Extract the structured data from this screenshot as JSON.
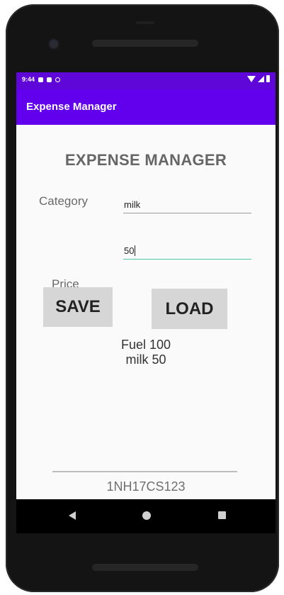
{
  "status_bar": {
    "time": "9:44"
  },
  "app_bar": {
    "title": "Expense Manager",
    "color": "#6200ee"
  },
  "main": {
    "heading": "EXPENSE MANAGER",
    "category_label": "Category",
    "category_value": "milk",
    "price_value": "50",
    "price_label": "Price",
    "save_label": "SAVE",
    "load_label": "LOAD",
    "records": [
      "Fuel 100",
      "milk 50"
    ],
    "footer_id": "1NH17CS123"
  },
  "nav": {
    "back_icon": "back-triangle",
    "home_icon": "home-circle",
    "recents_icon": "recents-square"
  }
}
